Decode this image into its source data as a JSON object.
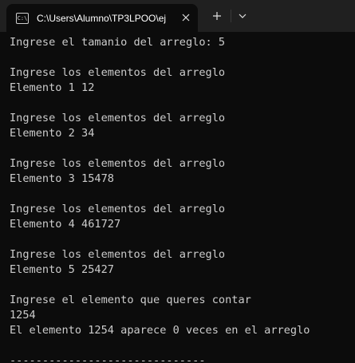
{
  "window": {
    "tab_title": "C:\\Users\\Alumno\\TP3LPOO\\ej",
    "tab_icon_glyph": "C:\\"
  },
  "colors": {
    "background": "#0c0c0c",
    "titlebar": "#202020",
    "text": "#cccccc"
  },
  "console": {
    "lines": [
      "Ingrese el tamanio del arreglo: 5",
      "",
      "Ingrese los elementos del arreglo",
      "Elemento 1 12",
      "",
      "Ingrese los elementos del arreglo",
      "Elemento 2 34",
      "",
      "Ingrese los elementos del arreglo",
      "Elemento 3 15478",
      "",
      "Ingrese los elementos del arreglo",
      "Elemento 4 461727",
      "",
      "Ingrese los elementos del arreglo",
      "Elemento 5 25427",
      "",
      "Ingrese el elemento que queres contar",
      "1254",
      "El elemento 1254 aparece 0 veces en el arreglo",
      "",
      "------------------------------"
    ]
  }
}
